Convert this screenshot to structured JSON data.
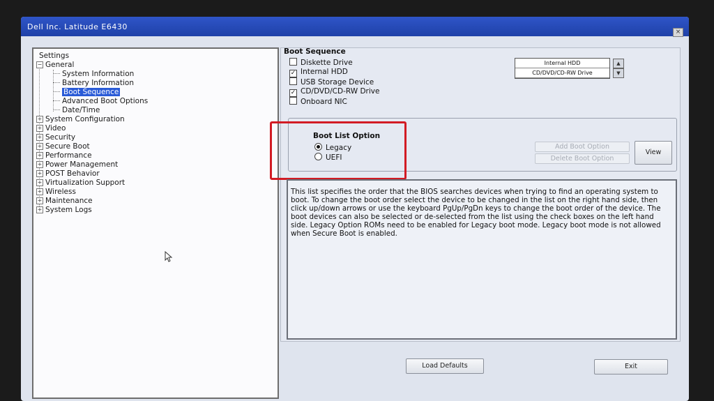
{
  "window": {
    "title": "Dell Inc. Latitude E6430",
    "close_glyph": "×"
  },
  "tree": {
    "root": "Settings",
    "general": "General",
    "general_children": [
      "System Information",
      "Battery Information",
      "Boot Sequence",
      "Advanced Boot Options",
      "Date/Time"
    ],
    "categories": [
      "System Configuration",
      "Video",
      "Security",
      "Secure Boot",
      "Performance",
      "Power Management",
      "POST Behavior",
      "Virtualization Support",
      "Wireless",
      "Maintenance",
      "System Logs"
    ],
    "selected": "Boot Sequence"
  },
  "boot_sequence": {
    "label": "Boot Sequence",
    "devices": [
      {
        "name": "Diskette Drive",
        "checked": false
      },
      {
        "name": "Internal HDD",
        "checked": true
      },
      {
        "name": "USB Storage Device",
        "checked": false
      },
      {
        "name": "CD/DVD/CD-RW Drive",
        "checked": true
      },
      {
        "name": "Onboard NIC",
        "checked": false
      }
    ],
    "order": [
      "Internal HDD",
      "CD/DVD/CD-RW Drive"
    ]
  },
  "boot_list_option": {
    "label": "Boot List Option",
    "options": [
      {
        "name": "Legacy",
        "selected": true
      },
      {
        "name": "UEFI",
        "selected": false
      }
    ],
    "add_button": "Add Boot Option",
    "delete_button": "Delete Boot Option",
    "view_button": "View"
  },
  "description": "This list specifies the order that the BIOS searches devices when trying to find an operating system to boot. To change the boot order select the device to be changed in the list on the right hand side, then click up/down arrows or use the keyboard PgUp/PgDn keys to change the boot order of the device. The boot devices can also be selected or de-selected from the list using the check boxes on the left hand side. Legacy Option ROMs need to be enabled for Legacy boot mode. Legacy boot mode is not allowed when Secure Boot is enabled.",
  "footer": {
    "load_defaults": "Load Defaults",
    "exit": "Exit"
  },
  "colors": {
    "highlight": "#d21b24",
    "selection": "#2a5bd7",
    "titlebar": "#2f55c8"
  }
}
